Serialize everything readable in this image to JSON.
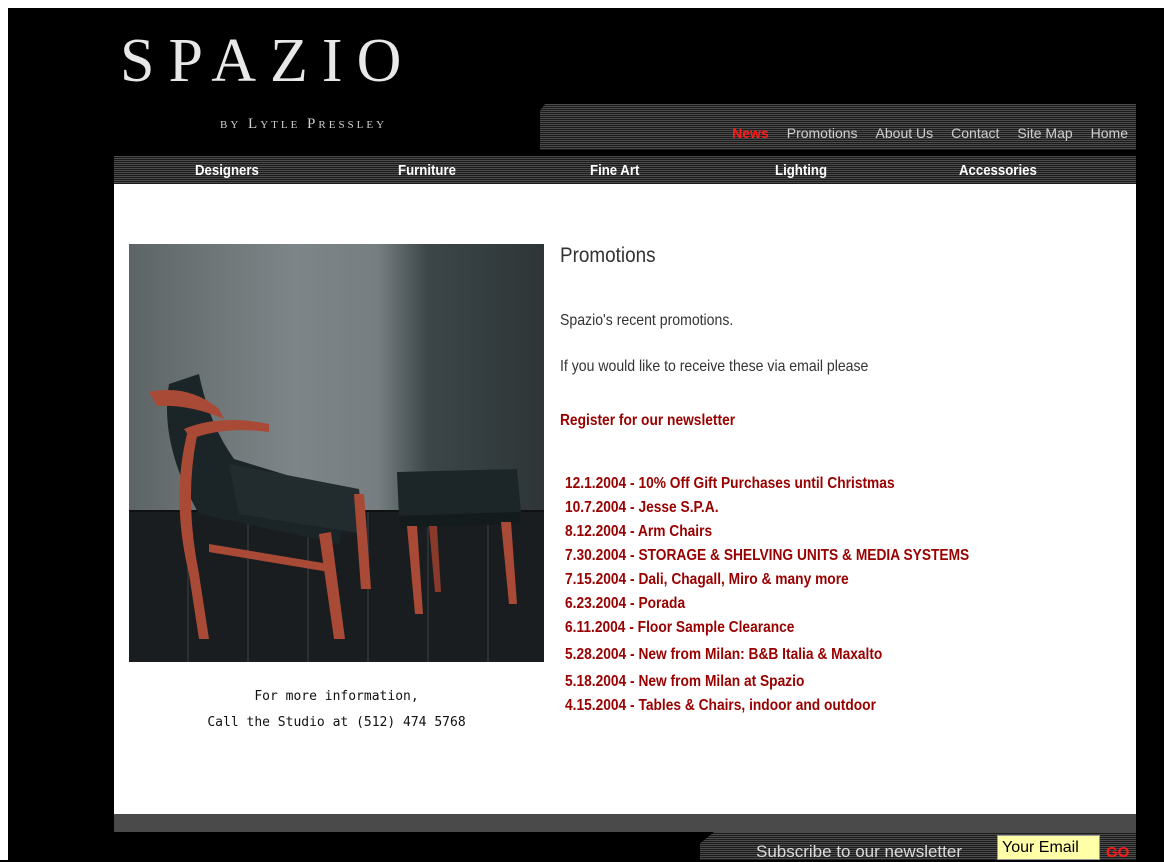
{
  "brand": {
    "name": "SPAZIO",
    "tagline": "by Lytle Pressley"
  },
  "top_nav": {
    "items": [
      "News",
      "Promotions",
      "About Us",
      "Contact",
      "Site Map",
      "Home"
    ],
    "active": "News",
    "active_color": "#ff1a1a"
  },
  "category_nav": {
    "items": [
      "Designers",
      "Furniture",
      "Fine Art",
      "Lighting",
      "Accessories"
    ]
  },
  "main": {
    "heading": "Promotions",
    "intro1": "Spazio's recent promotions.",
    "intro2": "If you would like to receive these via email please",
    "register_link": "Register for our newsletter",
    "promotions": [
      "12.1.2004 - 10% Off Gift Purchases until Christmas",
      "10.7.2004 - Jesse S.P.A.",
      "8.12.2004 - Arm Chairs",
      "7.30.2004 - STORAGE & SHELVING UNITS & MEDIA SYSTEMS",
      "7.15.2004 - Dali, Chagall, Miro & many more",
      "6.23.2004 - Porada",
      "6.11.2004 - Floor Sample Clearance",
      "5.28.2004 - New from Milan: B&B Italia & Maxalto",
      "5.18.2004 - New from Milan at Spazio",
      "4.15.2004 - Tables & Chairs, indoor and outdoor"
    ],
    "link_color": "#990000"
  },
  "sidebar": {
    "caption_line1": "For more information,",
    "caption_line2": "Call the Studio at (512) 474 5768"
  },
  "footer": {
    "subscribe_label": "Subscribe to our newsletter",
    "email_placeholder": "Your Email",
    "go_label": "GO"
  }
}
